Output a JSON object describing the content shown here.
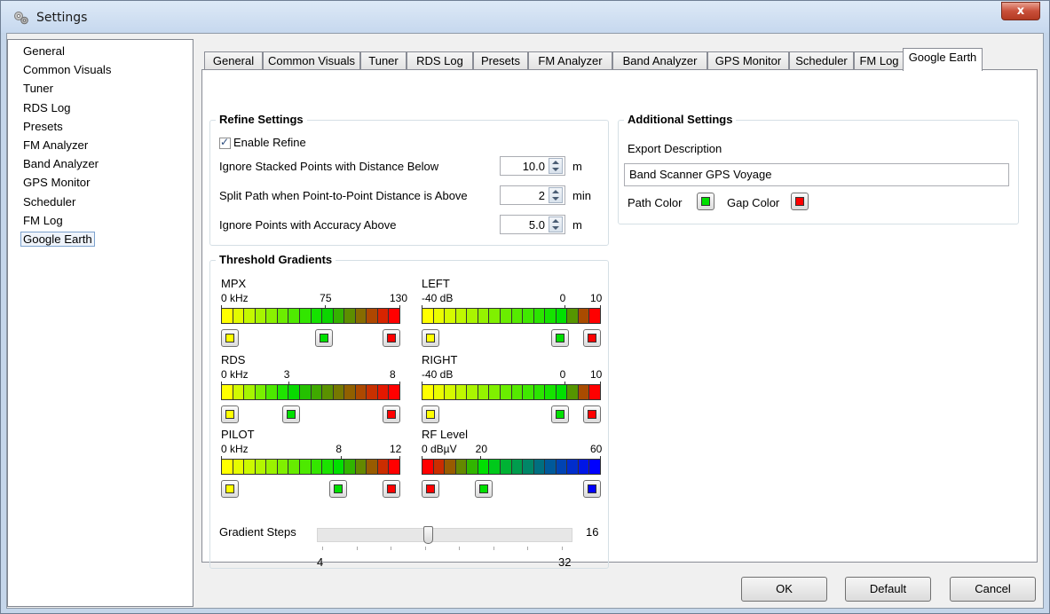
{
  "window": {
    "title": "Settings",
    "close_label": "x"
  },
  "nav": {
    "items": [
      "General",
      "Common Visuals",
      "Tuner",
      "RDS Log",
      "Presets",
      "FM Analyzer",
      "Band Analyzer",
      "GPS Monitor",
      "Scheduler",
      "FM Log",
      "Google Earth"
    ],
    "selected": "Google Earth"
  },
  "tabs": [
    "General",
    "Common Visuals",
    "Tuner",
    "RDS Log",
    "Presets",
    "FM Analyzer",
    "Band Analyzer",
    "GPS Monitor",
    "Scheduler",
    "FM Log",
    "Google Earth"
  ],
  "active_tab": "Google Earth",
  "refine": {
    "title": "Refine Settings",
    "enable_label": "Enable Refine",
    "enable_checked": true,
    "stacked_label": "Ignore Stacked Points with Distance Below",
    "stacked_value": "10.0",
    "stacked_unit": "m",
    "split_label": "Split Path when Point-to-Point Distance is Above",
    "split_value": "2",
    "split_unit": "min",
    "accuracy_label": "Ignore Points with Accuracy Above",
    "accuracy_value": "5.0",
    "accuracy_unit": "m"
  },
  "additional": {
    "title": "Additional Settings",
    "export_label": "Export Description",
    "export_value": "Band Scanner GPS Voyage",
    "path_color_label": "Path Color",
    "path_color": "#00e000",
    "gap_color_label": "Gap Color",
    "gap_color": "#ff0000"
  },
  "gradients": {
    "title": "Threshold Gradients",
    "mpx": {
      "name": "MPX",
      "ticks": [
        "0 kHz",
        "75",
        "130"
      ],
      "colors": [
        "#ffff00",
        "#00e000",
        "#ff0000"
      ]
    },
    "rds": {
      "name": "RDS",
      "ticks": [
        "0 kHz",
        "3",
        "8"
      ],
      "colors": [
        "#ffff00",
        "#00e000",
        "#ff0000"
      ]
    },
    "pilot": {
      "name": "PILOT",
      "ticks": [
        "0 kHz",
        "8",
        "12"
      ],
      "colors": [
        "#ffff00",
        "#00e000",
        "#ff0000"
      ]
    },
    "left": {
      "name": "LEFT",
      "ticks": [
        "-40 dB",
        "0",
        "10"
      ],
      "colors": [
        "#ffff00",
        "#00e000",
        "#ff0000"
      ]
    },
    "right": {
      "name": "RIGHT",
      "ticks": [
        "-40 dB",
        "0",
        "10"
      ],
      "colors": [
        "#ffff00",
        "#00e000",
        "#ff0000"
      ]
    },
    "rflevel": {
      "name": "RF Level",
      "ticks": [
        "0 dBµV",
        "20",
        "60"
      ],
      "colors": [
        "#ff0000",
        "#00e000",
        "#0000ff"
      ]
    },
    "steps_label": "Gradient Steps",
    "steps_value": "16",
    "steps_min": "4",
    "steps_max": "32"
  },
  "buttons": {
    "ok": "OK",
    "default": "Default",
    "cancel": "Cancel"
  }
}
